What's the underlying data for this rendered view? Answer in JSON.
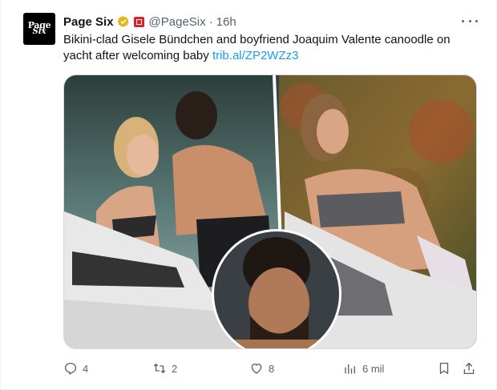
{
  "tweet": {
    "account_name": "Page Six",
    "handle": "@PageSix",
    "separator": "·",
    "time": "16h",
    "avatar_line1": "Page",
    "avatar_line2": "Six",
    "text": "Bikini-clad Gisele Bündchen and boyfriend Joaquim Valente canoodle on yacht after welcoming baby",
    "link": "trib.al/ZP2WZz3"
  },
  "actions": {
    "replies": "4",
    "reposts": "2",
    "likes": "8",
    "views": "6 mil"
  },
  "colors": {
    "link": "#1d9bf0",
    "secondary_text": "#536471",
    "verified_gold": "#e2b719",
    "affiliate_red": "#d8232a"
  },
  "icons": [
    "verified-badge-icon",
    "affiliate-badge-icon",
    "more-icon",
    "reply-icon",
    "repost-icon",
    "like-icon",
    "views-icon",
    "bookmark-icon",
    "share-icon"
  ]
}
